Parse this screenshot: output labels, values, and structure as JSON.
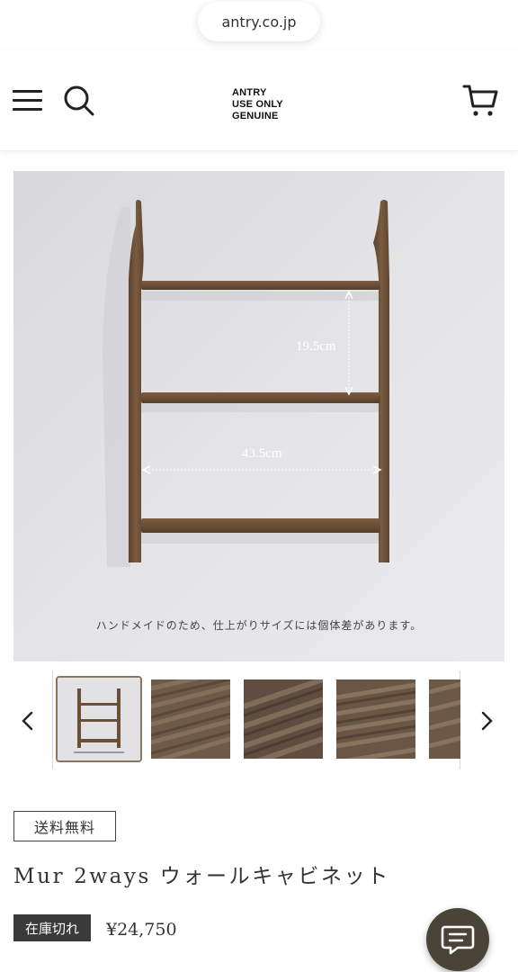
{
  "browser": {
    "url": "antry.co.jp"
  },
  "header": {
    "logo_lines": [
      "ANTRY",
      "USE ONLY",
      "GENUINE"
    ],
    "icons": [
      "menu-icon",
      "search-icon",
      "cart-icon"
    ]
  },
  "main_image": {
    "dimension_height": "19.5cm",
    "dimension_width": "43.5cm",
    "caption": "ハンドメイドのため、仕上がりサイズには個体差があります。"
  },
  "thumbnails": {
    "count_visible": 5,
    "selected_index": 0,
    "icons": [
      "chevron-left-icon",
      "chevron-right-icon"
    ]
  },
  "product": {
    "shipping_badge": "送料無料",
    "title": "Mur 2ways ウォールキャビネット",
    "stock_status": "在庫切れ",
    "price": "¥24,750"
  },
  "colors": {
    "wood": "#6b5038",
    "wall": "#e3e3e6",
    "stock_badge_bg": "#3a3a3a",
    "chat_button_bg": "#4a4338"
  }
}
